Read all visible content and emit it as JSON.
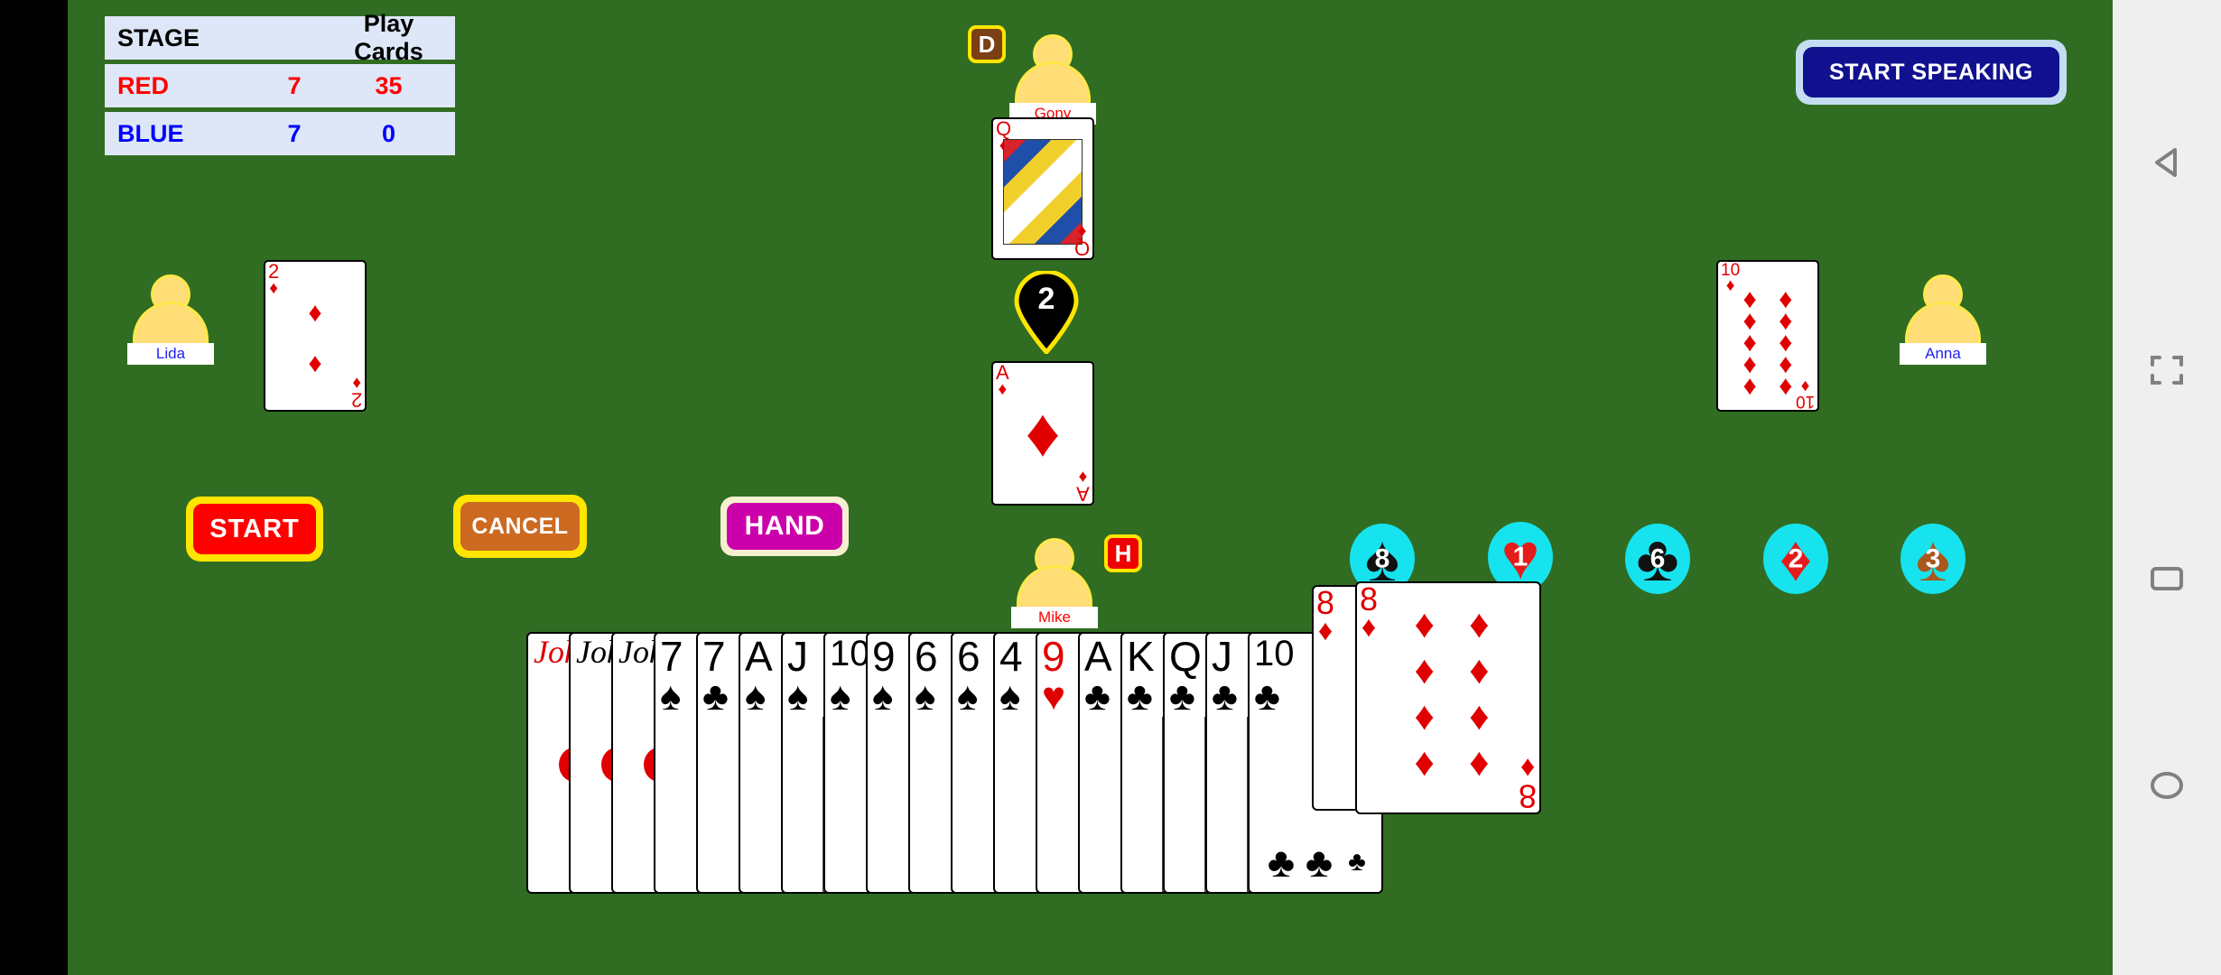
{
  "app": {
    "table_color": "#306d22"
  },
  "score": {
    "header": {
      "stage_label": "STAGE",
      "blank": "",
      "play_label": "Play Cards"
    },
    "rows": [
      {
        "team": "RED",
        "stage": "7",
        "cards": "35",
        "color": "#ff0000"
      },
      {
        "team": "BLUE",
        "stage": "7",
        "cards": "0",
        "color": "#0000ff"
      }
    ]
  },
  "speak": {
    "label": "START SPEAKING",
    "bg": "#11118f",
    "border": "#c5ddf2"
  },
  "players": [
    {
      "name": "Gony",
      "name_color": "red",
      "card": {
        "rank": "Q",
        "suit": "diamond"
      },
      "badge": "D",
      "badge_type": "dealer"
    },
    {
      "name": "Lida",
      "name_color": "blue",
      "card": {
        "rank": "2",
        "suit": "diamond"
      }
    },
    {
      "name": "Anna",
      "name_color": "blue",
      "card": {
        "rank": "10",
        "suit": "diamond"
      }
    },
    {
      "name": "Mike",
      "name_color": "red",
      "card": {
        "rank": "A",
        "suit": "diamond"
      },
      "badge": "H",
      "badge_type": "host"
    }
  ],
  "turn_marker": {
    "value": "2",
    "fill": "#000000",
    "stroke": "#ffe500"
  },
  "buttons": [
    {
      "label": "START",
      "bg": "#ff0000",
      "border": "#ffe500"
    },
    {
      "label": "CANCEL",
      "bg": "#cc6a22",
      "border": "#ffe500"
    },
    {
      "label": "HAND",
      "bg": "#cc00aa",
      "border": "#f5f0cf"
    }
  ],
  "suit_chips": [
    {
      "suit": "spade",
      "glyph": "♠",
      "count": "8",
      "style": "black",
      "bg": "#16e3ee"
    },
    {
      "suit": "heart",
      "glyph": "♥",
      "count": "1",
      "style": "red",
      "bg": "#16e3ee"
    },
    {
      "suit": "club",
      "glyph": "♣",
      "count": "6",
      "style": "black",
      "bg": "#16e3ee"
    },
    {
      "suit": "diamond",
      "glyph": "♦",
      "count": "2",
      "style": "red",
      "bg": "#16e3ee"
    },
    {
      "suit": "spade",
      "glyph": "♠",
      "count": "3",
      "style": "ornate",
      "bg": "#16e3ee"
    }
  ],
  "hand": {
    "cards": [
      {
        "rank": "Joker",
        "suit": "joker",
        "color": "red",
        "art": false
      },
      {
        "rank": "Joker",
        "suit": "joker",
        "color": "black",
        "art": false
      },
      {
        "rank": "Joker",
        "suit": "joker",
        "color": "black",
        "art": false
      },
      {
        "rank": "7",
        "suit": "spade",
        "glyph": "♠",
        "color": "black",
        "art": false
      },
      {
        "rank": "7",
        "suit": "club",
        "glyph": "♣",
        "color": "black",
        "art": false
      },
      {
        "rank": "A",
        "suit": "spade",
        "glyph": "♠",
        "color": "black",
        "art": false
      },
      {
        "rank": "J",
        "suit": "spade",
        "glyph": "♠",
        "color": "black",
        "art": true
      },
      {
        "rank": "10",
        "suit": "spade",
        "glyph": "♠",
        "color": "black",
        "art": false
      },
      {
        "rank": "9",
        "suit": "spade",
        "glyph": "♠",
        "color": "black",
        "art": false
      },
      {
        "rank": "6",
        "suit": "spade",
        "glyph": "♠",
        "color": "black",
        "art": false
      },
      {
        "rank": "6",
        "suit": "spade",
        "glyph": "♠",
        "color": "black",
        "art": false
      },
      {
        "rank": "4",
        "suit": "spade",
        "glyph": "♠",
        "color": "black",
        "art": false
      },
      {
        "rank": "9",
        "suit": "heart",
        "glyph": "♥",
        "color": "red",
        "art": false
      },
      {
        "rank": "A",
        "suit": "club",
        "glyph": "♣",
        "color": "black",
        "art": false
      },
      {
        "rank": "K",
        "suit": "club",
        "glyph": "♣",
        "color": "black",
        "art": true
      },
      {
        "rank": "Q",
        "suit": "club",
        "glyph": "♣",
        "color": "black",
        "art": true
      },
      {
        "rank": "J",
        "suit": "club",
        "glyph": "♣",
        "color": "black",
        "art": true
      },
      {
        "rank": "10",
        "suit": "club",
        "glyph": "♣",
        "color": "black",
        "art": false
      }
    ],
    "raised": [
      {
        "rank": "8",
        "suit": "diamond",
        "glyph": "♦",
        "color": "red"
      },
      {
        "rank": "8",
        "suit": "diamond",
        "glyph": "♦",
        "color": "red"
      }
    ]
  },
  "navbar": {
    "items": [
      {
        "icon": "back-triangle-icon"
      },
      {
        "icon": "fullscreen-icon"
      },
      {
        "icon": "recents-square-icon"
      },
      {
        "icon": "home-circle-icon"
      }
    ]
  }
}
